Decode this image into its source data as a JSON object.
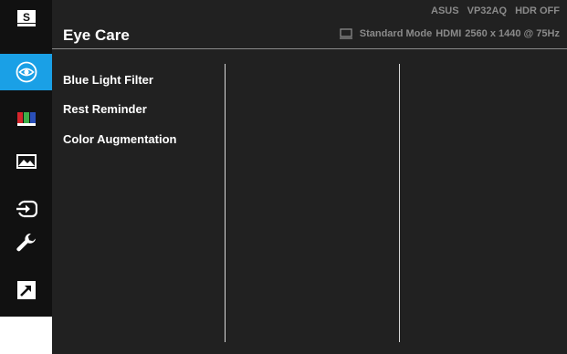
{
  "header": {
    "title": "Eye Care",
    "model": "ASUS",
    "model_name": "VP32AQ",
    "hdr": "HDR OFF",
    "mode": "Standard Mode",
    "input": "HDMI",
    "resolution": "2560 x 1440 @ 75Hz"
  },
  "sidebar": {
    "items": [
      {
        "name": "splendid",
        "icon": "s-logo-icon",
        "label": "S"
      },
      {
        "name": "eye-care",
        "icon": "eye-icon",
        "active": true
      },
      {
        "name": "color",
        "icon": "color-bars-icon"
      },
      {
        "name": "image",
        "icon": "image-icon"
      },
      {
        "name": "input-select",
        "icon": "input-select-icon"
      },
      {
        "name": "system-setup",
        "icon": "wrench-icon"
      },
      {
        "name": "shortcut",
        "icon": "shortcut-arrow-icon"
      }
    ]
  },
  "menu": {
    "items": [
      {
        "label": "Blue Light Filter"
      },
      {
        "label": "Rest Reminder"
      },
      {
        "label": "Color Augmentation"
      }
    ]
  },
  "colors": {
    "accent": "#1aa0e6",
    "background": "#212121",
    "sidebar": "#111111",
    "text": "#ffffff",
    "status_text": "#8a8a8a"
  }
}
